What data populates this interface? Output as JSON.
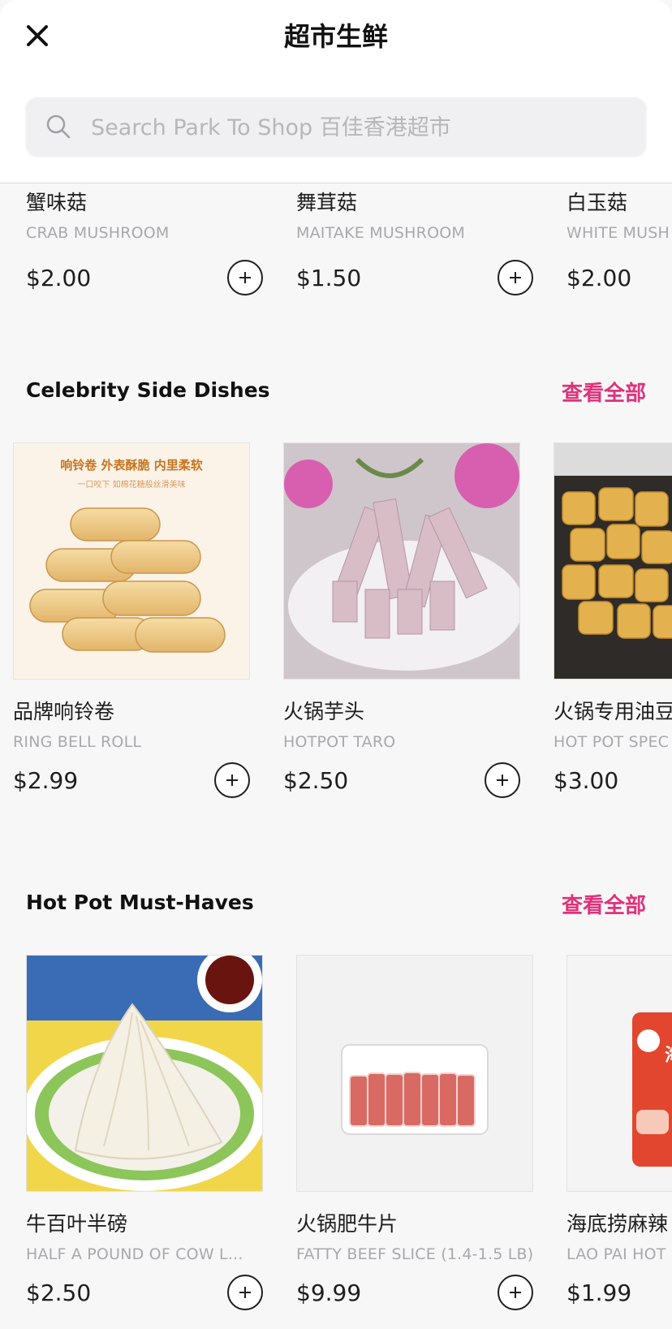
{
  "header": {
    "title": "超市生鲜",
    "close_icon": "close-icon",
    "search": {
      "placeholder": "Search Park To Shop 百佳香港超市",
      "value": "",
      "icon": "search-icon"
    }
  },
  "top_row": {
    "items": [
      {
        "name_cn": "蟹味菇",
        "name_en": "CRAB MUSHROOM",
        "price": "$2.00"
      },
      {
        "name_cn": "舞茸菇",
        "name_en": "MAITAKE MUSHROOM",
        "price": "$1.50"
      },
      {
        "name_cn": "白玉菇",
        "name_en": "WHITE MUSH",
        "price": "$2.00"
      }
    ]
  },
  "sections": [
    {
      "title": "Celebrity Side Dishes",
      "view_all": "查看全部",
      "items": [
        {
          "name_cn": "品牌响铃卷",
          "name_en": "RING BELL ROLL",
          "price": "$2.99",
          "image_text_line1": "响铃卷 外表酥脆 内里柔软",
          "image_text_line2": "一口咬下 如棉花糖般丝滑美味"
        },
        {
          "name_cn": "火锅芋头",
          "name_en": "HOTPOT TARO",
          "price": "$2.50"
        },
        {
          "name_cn": "火锅专用油豆",
          "name_en": "HOT POT SPEC",
          "price": "$3.00"
        }
      ]
    },
    {
      "title": "Hot Pot Must-Haves",
      "view_all": "查看全部",
      "items": [
        {
          "name_cn": "牛百叶半磅",
          "name_en": "HALF A POUND OF COW L...",
          "price": "$2.50"
        },
        {
          "name_cn": "火锅肥牛片",
          "name_en": "FATTY BEEF SLICE (1.4-1.5 LB)",
          "price": "$9.99"
        },
        {
          "name_cn": "海底捞麻辣",
          "name_en": "LAO PAI HOT",
          "price": "$1.99",
          "image_brand_text": "海底捞"
        }
      ]
    }
  ],
  "colors": {
    "accent": "#e0327a",
    "background": "#f7f7f8",
    "text": "#1a1a1a",
    "muted": "#a9a9ad"
  }
}
